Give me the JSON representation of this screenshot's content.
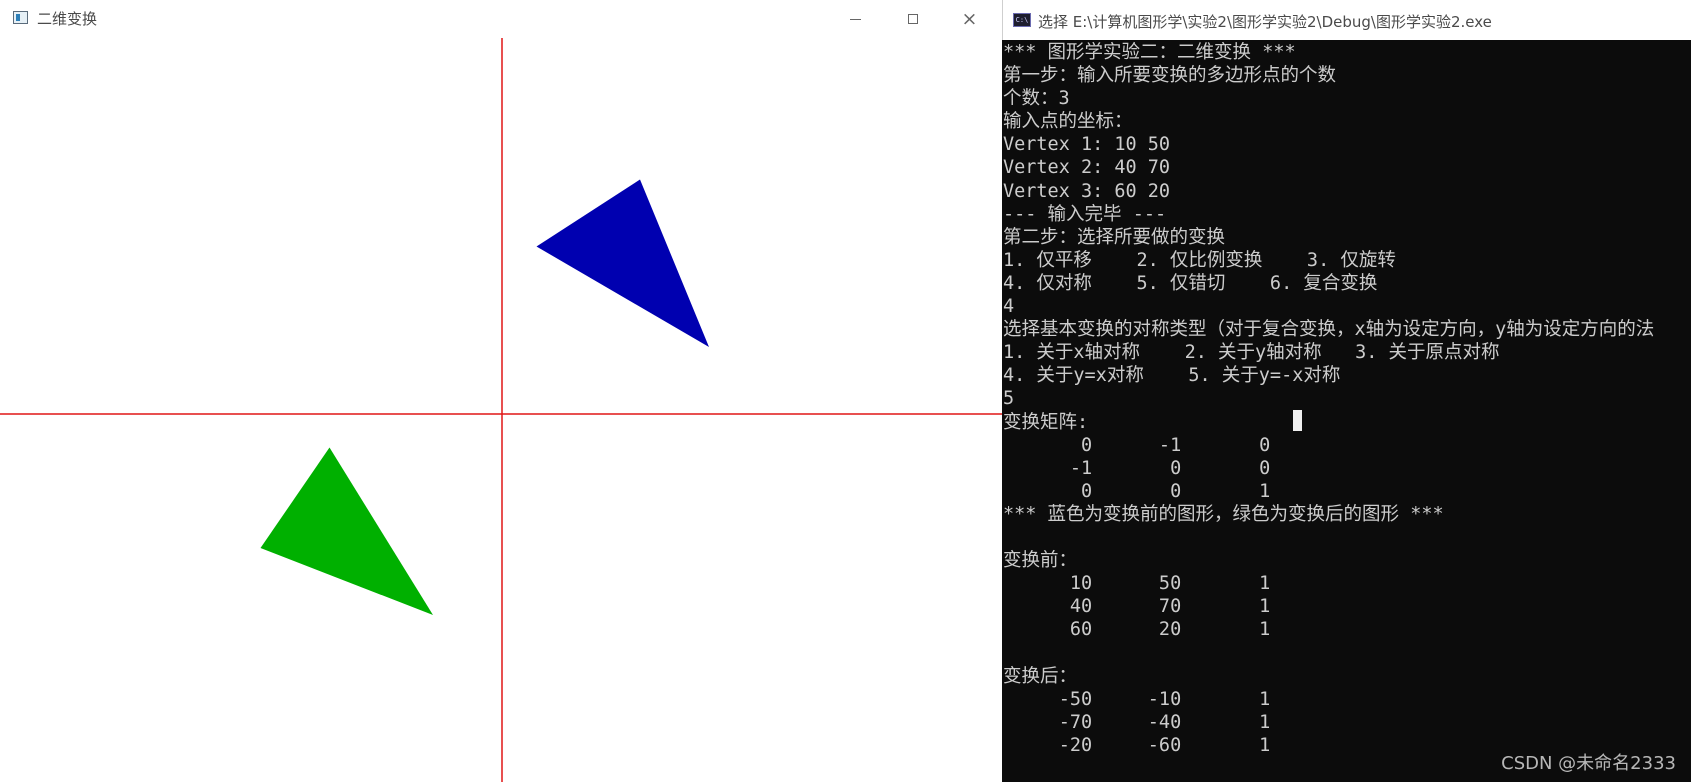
{
  "graphics_window": {
    "title": "二维变换",
    "controls": {
      "minimize": "minimize",
      "maximize": "maximize",
      "close": "×"
    },
    "colors": {
      "axis": "#e01616",
      "before_shape": "#0000b0",
      "after_shape": "#00b000",
      "background": "#ffffff"
    },
    "polygons": {
      "before": [
        [
          10,
          50
        ],
        [
          40,
          70
        ],
        [
          60,
          20
        ]
      ],
      "after": [
        [
          -50,
          -10
        ],
        [
          -70,
          -40
        ],
        [
          -20,
          -60
        ]
      ]
    }
  },
  "console_window": {
    "title": "选择 E:\\计算机图形学\\实验2\\图形学实验2\\Debug\\图形学实验2.exe",
    "icon_label": "C:\\",
    "lines": [
      "*** 图形学实验二：二维变换 ***",
      "第一步：输入所要变换的多边形点的个数",
      "个数：3",
      "输入点的坐标：",
      "Vertex 1: 10 50",
      "Vertex 2: 40 70",
      "Vertex 3: 60 20",
      "--- 输入完毕 ---",
      "第二步：选择所要做的变换",
      "1. 仅平移    2. 仅比例变换    3. 仅旋转",
      "4. 仅对称    5. 仅错切    6. 复合变换",
      "4",
      "选择基本变换的对称类型（对于复合变换，x轴为设定方向，y轴为设定方向的法",
      "1. 关于x轴对称    2. 关于y轴对称   3. 关于原点对称",
      "4. 关于y=x对称    5. 关于y=-x对称",
      "5",
      "变换矩阵:",
      "       0      -1       0",
      "      -1       0       0",
      "       0       0       1",
      "*** 蓝色为变换前的图形，绿色为变换后的图形 ***",
      "",
      "变换前：",
      "      10      50       1",
      "      40      70       1",
      "      60      20       1",
      "",
      "变换后：",
      "     -50     -10       1",
      "     -70     -40       1",
      "     -20     -60       1"
    ],
    "colors": {
      "background": "#0c0c0c",
      "text": "#cccccc"
    }
  },
  "watermark": "CSDN @未命名2333"
}
